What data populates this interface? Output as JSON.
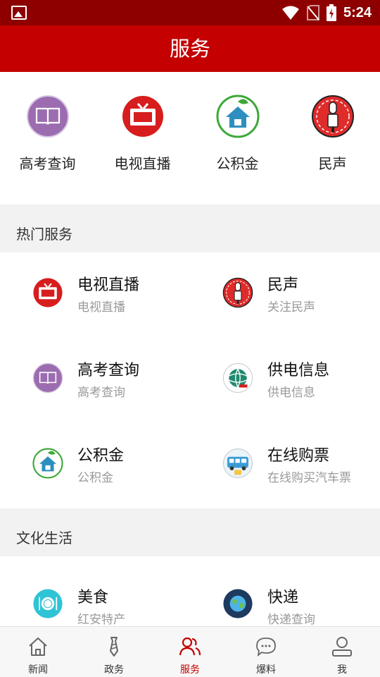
{
  "status_bar": {
    "time": "5:24"
  },
  "app_bar": {
    "title": "服务"
  },
  "quick_items": [
    {
      "label": "高考查询",
      "icon": "book-icon"
    },
    {
      "label": "电视直播",
      "icon": "tv-icon"
    },
    {
      "label": "公积金",
      "icon": "house-leaf-icon"
    },
    {
      "label": "民声",
      "icon": "microphone-icon"
    }
  ],
  "hot_services": {
    "title": "热门服务",
    "items": [
      {
        "name": "电视直播",
        "sub": "电视直播",
        "icon": "tv-icon"
      },
      {
        "name": "民声",
        "sub": "关注民声",
        "icon": "microphone-icon"
      },
      {
        "name": "高考查询",
        "sub": "高考查询",
        "icon": "book-icon"
      },
      {
        "name": "供电信息",
        "sub": "供电信息",
        "icon": "power-grid-globe-icon"
      },
      {
        "name": "公积金",
        "sub": "公积金",
        "icon": "house-leaf-icon"
      },
      {
        "name": "在线购票",
        "sub": "在线购买汽车票",
        "icon": "bus-icon"
      }
    ]
  },
  "culture_life": {
    "title": "文化生活",
    "items": [
      {
        "name": "美食",
        "sub": "红安特产",
        "icon": "plate-icon"
      },
      {
        "name": "快递",
        "sub": "快递查询",
        "icon": "globe-icon"
      }
    ]
  },
  "tab_bar": {
    "active": "服务",
    "tabs": [
      {
        "label": "新闻",
        "icon": "home-icon"
      },
      {
        "label": "政务",
        "icon": "tie-icon"
      },
      {
        "label": "服务",
        "icon": "people-icon"
      },
      {
        "label": "爆料",
        "icon": "chat-bubble-icon"
      },
      {
        "label": "我",
        "icon": "person-icon"
      }
    ]
  },
  "colors": {
    "primary": "#c40000",
    "status_bar": "#8e0000",
    "background": "#f2f2f2"
  }
}
